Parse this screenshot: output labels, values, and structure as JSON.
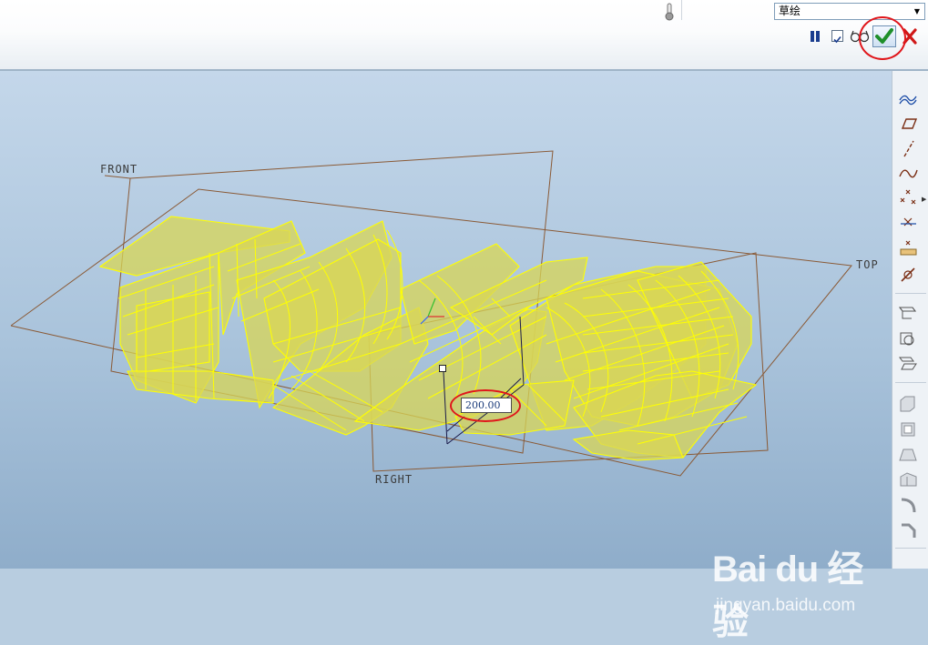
{
  "dashboard": {
    "mode_select": {
      "value": "草绘"
    },
    "buttons": {
      "pause": "pause-icon",
      "verify": "checkbox-icon",
      "preview": "glasses-icon",
      "ok": "checkmark-icon",
      "cancel": "close-icon"
    },
    "colors": {
      "ok_check": "#1e8f2a",
      "cancel_x": "#d01818",
      "highlight": "#e0161b"
    }
  },
  "viewport": {
    "planes": {
      "front": "FRONT",
      "top": "TOP",
      "right": "RIGHT"
    },
    "dimension": {
      "value": "200.00"
    },
    "colors": {
      "model_edges": "#ffff00",
      "model_fill": "#d8d655",
      "datum_plane": "#8a5a36"
    }
  },
  "right_toolbar": {
    "items": [
      "sketch-curve-icon",
      "datum-plane-icon",
      "datum-axis-icon",
      "datum-curve-icon",
      "datum-point-icon",
      "offset-point-icon",
      "field-point-icon",
      "coordinate-system-icon",
      "extrude-tool-icon",
      "revolve-tool-icon",
      "sweep-tool-icon",
      "shell-icon",
      "rib-icon",
      "draft-icon",
      "hole-icon",
      "round-icon",
      "chamfer-icon"
    ]
  },
  "watermark": {
    "brand": "Bai du 经验",
    "url": "jingyan.baidu.com"
  }
}
